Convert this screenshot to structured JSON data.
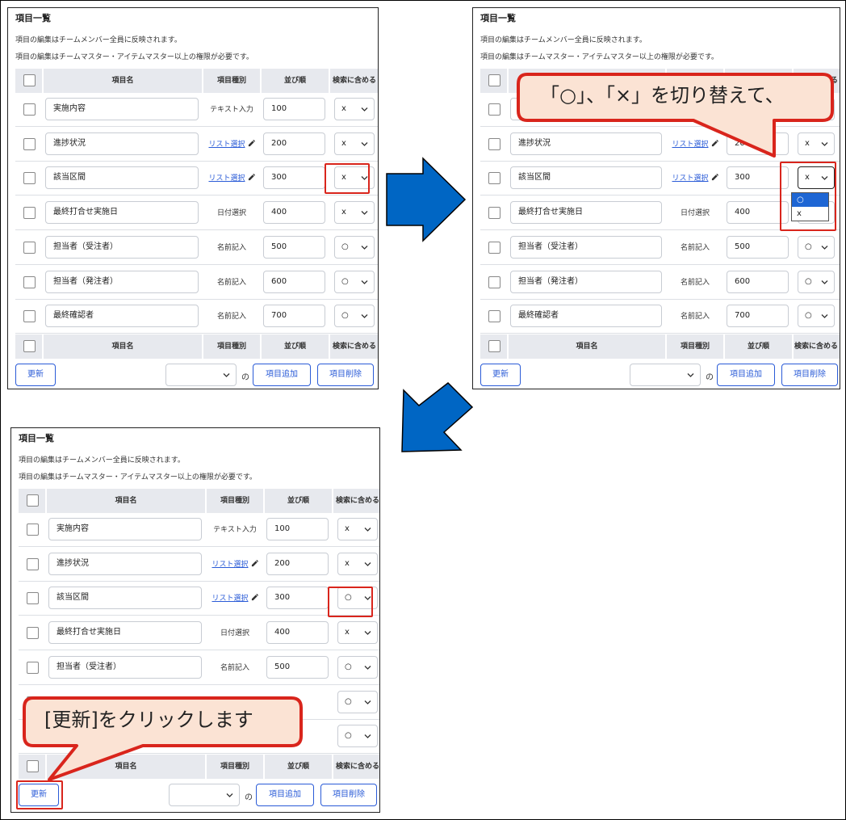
{
  "panel": {
    "title": "項目一覧",
    "desc1": "項目の編集はチームメンバー全員に反映されます。",
    "desc2": "項目の編集はチームマスター・アイテムマスター以上の権限が必要です。",
    "columns": [
      "項目名",
      "項目種別",
      "並び順",
      "検索に含める"
    ],
    "update_label": "更新",
    "of_label": "の",
    "add_label": "項目追加",
    "delete_label": "項目削除"
  },
  "rows_before": [
    {
      "name": "実施内容",
      "kind": "テキスト入力",
      "order": "100",
      "search": "x"
    },
    {
      "name": "進捗状況",
      "kind": "リスト選択",
      "order": "200",
      "search": "x"
    },
    {
      "name": "該当区間",
      "kind": "リスト選択",
      "order": "300",
      "search": "x"
    },
    {
      "name": "最終打合せ実施日",
      "kind": "日付選択",
      "order": "400",
      "search": "x"
    },
    {
      "name": "担当者（受注者）",
      "kind": "名前記入",
      "order": "500",
      "search": "○"
    },
    {
      "name": "担当者（発注者）",
      "kind": "名前記入",
      "order": "600",
      "search": "○"
    },
    {
      "name": "最終確認者",
      "kind": "名前記入",
      "order": "700",
      "search": "○"
    }
  ],
  "rows_after": [
    {
      "name": "実施内容",
      "kind": "テキスト入力",
      "order": "100",
      "search": "x"
    },
    {
      "name": "進捗状況",
      "kind": "リスト選択",
      "order": "200",
      "search": "x"
    },
    {
      "name": "該当区間",
      "kind": "リスト選択",
      "order": "300",
      "search": "○"
    },
    {
      "name": "最終打合せ実施日",
      "kind": "日付選択",
      "order": "400",
      "search": "x"
    },
    {
      "name": "担当者（受注者）",
      "kind": "名前記入",
      "order": "500",
      "search": "○"
    },
    {
      "name": "",
      "kind": "",
      "order": "",
      "search": "○"
    },
    {
      "name": "",
      "kind": "",
      "order": "",
      "search": "○"
    }
  ],
  "dropdown_options": [
    "○",
    "x"
  ],
  "callout_top": "「○」、「×」を切り替えて、",
  "callout_bottom": "[更新]をクリックします",
  "colors": {
    "accent": "#2a5bd7",
    "highlight": "#d9251c",
    "arrow": "#0066c4",
    "callout_fill": "#fbe3d4"
  }
}
